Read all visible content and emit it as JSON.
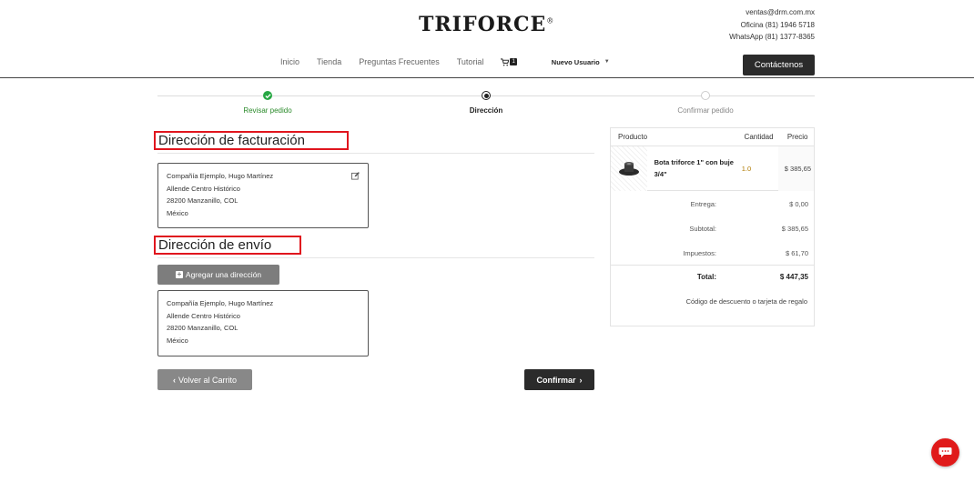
{
  "brand": {
    "logo": "TRIFORCE",
    "registered": "®"
  },
  "contact": {
    "email": "ventas@drm.com.mx",
    "office": "Oficina (81) 1946 5718",
    "whatsapp": "WhatsApp (81) 1377-8365"
  },
  "nav": {
    "items": [
      "Inicio",
      "Tienda",
      "Preguntas Frecuentes",
      "Tutorial"
    ],
    "cart_icon": "shopping-cart-icon",
    "cart_count": "1",
    "user": "Nuevo Usuario",
    "contact_button": "Contáctenos"
  },
  "steps": [
    {
      "label": "Revisar pedido",
      "state": "done"
    },
    {
      "label": "Dirección",
      "state": "active"
    },
    {
      "label": "Confirmar pedido",
      "state": "pending"
    }
  ],
  "billing": {
    "title": "Dirección de facturación",
    "lines": [
      "Compañía Ejemplo, Hugo Martínez",
      "Allende Centro Histórico",
      "28200 Manzanillo, COL",
      "México"
    ]
  },
  "shipping": {
    "title": "Dirección de envío",
    "add_button": "Agregar una dirección",
    "lines": [
      "Compañía Ejemplo, Hugo Martínez",
      "Allende Centro Histórico",
      "28200 Manzanillo, COL",
      "México"
    ]
  },
  "actions": {
    "back": "Volver al Carrito",
    "confirm": "Confirmar"
  },
  "summary": {
    "headers": {
      "product": "Producto",
      "qty": "Cantidad",
      "price": "Precio"
    },
    "item": {
      "name": "Bota triforce 1\" con buje 3/4\"",
      "qty": "1.0",
      "price": "$ 385,65"
    },
    "rows": [
      {
        "label": "Entrega:",
        "value": "$ 0,00"
      },
      {
        "label": "Subtotal:",
        "value": "$ 385,65"
      },
      {
        "label": "Impuestos:",
        "value": "$ 61,70"
      }
    ],
    "total": {
      "label": "Total:",
      "value": "$ 447,35"
    },
    "discount": "Código de descuento o tarjeta de regalo"
  },
  "colors": {
    "accent_green": "#27a744",
    "highlight_red": "#e0161e",
    "chat_red": "#e01a1a",
    "dark": "#2b2b2b"
  }
}
